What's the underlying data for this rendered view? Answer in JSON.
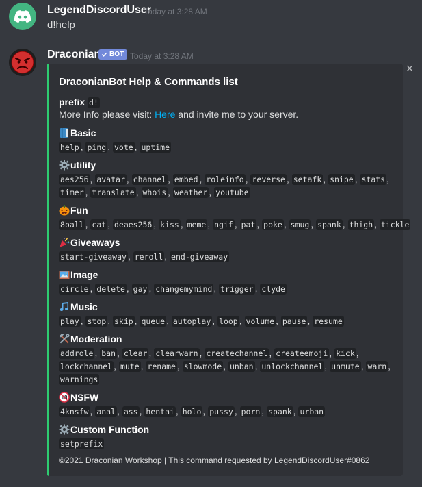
{
  "messages": [
    {
      "username": "LegendDiscordUser",
      "timestamp": "Today at 3:28 AM",
      "content": "d!help"
    },
    {
      "username": "Draconian",
      "bot_tag": "BOT",
      "timestamp": "Today at 3:28 AM"
    }
  ],
  "embed": {
    "accent_color": "#2ecc71",
    "close_icon": "close-icon",
    "title": "DraconianBot Help & Commands list",
    "prefix_label": "prefix",
    "prefix_value": "d!",
    "info_before": "More Info please visit: ",
    "info_link": "Here",
    "info_after": " and invite me to your server.",
    "fields": [
      {
        "icon": "blue-book-icon",
        "name": "Basic",
        "lines": [
          [
            "help",
            "ping",
            "vote",
            "uptime"
          ]
        ]
      },
      {
        "icon": "gear-icon",
        "name": "utility",
        "lines": [
          [
            "aes256",
            "avatar",
            "channel",
            "embed",
            "roleinfo",
            "reverse",
            "setafk",
            "snipe",
            "stats",
            ""
          ],
          [
            "timer",
            "translate",
            "whois",
            "weather",
            "youtube"
          ]
        ]
      },
      {
        "icon": "jack-o-lantern-icon",
        "name": "Fun",
        "lines": [
          [
            "8ball",
            "cat",
            "deaes256",
            "kiss",
            "meme",
            "ngif",
            "pat",
            "poke",
            "smug",
            "spank",
            "thigh",
            "tickle"
          ]
        ]
      },
      {
        "icon": "party-popper-icon",
        "name": "Giveaways",
        "lines": [
          [
            "start-giveaway",
            "reroll",
            "end-giveaway"
          ]
        ]
      },
      {
        "icon": "framed-picture-icon",
        "name": "Image",
        "lines": [
          [
            "circle",
            "delete",
            "gay",
            "changemymind",
            "trigger",
            "clyde"
          ]
        ]
      },
      {
        "icon": "musical-notes-icon",
        "name": "Music",
        "lines": [
          [
            "play",
            "stop",
            "skip",
            "queue",
            "autoplay",
            "loop",
            "volume",
            "pause",
            "resume"
          ]
        ]
      },
      {
        "icon": "hammer-and-wrench-icon",
        "name": "Moderation",
        "lines": [
          [
            "addrole",
            "ban",
            "clear",
            "clearwarn",
            "createchannel",
            "createemoji",
            "kick",
            ""
          ],
          [
            "lockchannel",
            "mute",
            "rename",
            "slowmode",
            "unban",
            "unlockchannel",
            "unmute",
            "warn",
            ""
          ],
          [
            "warnings"
          ]
        ]
      },
      {
        "icon": "no-one-under-eighteen-icon",
        "name": "NSFW",
        "lines": [
          [
            "4knsfw",
            "anal",
            "ass",
            "hentai",
            "holo",
            "pussy",
            "porn",
            "spank",
            "urban"
          ]
        ]
      },
      {
        "icon": "gear-icon",
        "name": "Custom Function",
        "lines": [
          [
            "setprefix"
          ]
        ]
      }
    ],
    "footer": "©2021 Draconian Workshop | This command requested by LegendDiscordUser#0862"
  }
}
